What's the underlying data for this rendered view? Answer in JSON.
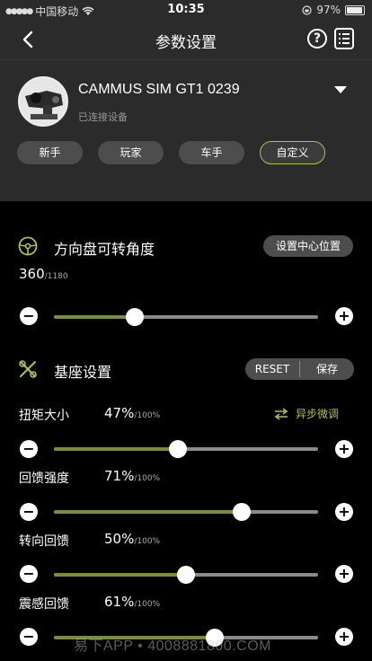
{
  "status_bar": {
    "carrier": "中国移动",
    "time": "10:35",
    "battery_text": "97%",
    "battery_level": 0.97
  },
  "header": {
    "title": "参数设置",
    "help_label": "?"
  },
  "device": {
    "name": "CAMMUS SIM GT1 0239",
    "status": "已连接设备",
    "modes": [
      {
        "label": "新手",
        "active": false
      },
      {
        "label": "玩家",
        "active": false
      },
      {
        "label": "车手",
        "active": false
      },
      {
        "label": "自定义",
        "active": true
      }
    ]
  },
  "steering": {
    "title": "方向盘可转角度",
    "center_button": "设置中心位置",
    "value": "360",
    "max": "/1180",
    "fraction": 0.305
  },
  "base": {
    "title": "基座设置",
    "reset_label": "RESET",
    "save_label": "保存",
    "async_label": "异步微调",
    "params": [
      {
        "label": "扭矩大小",
        "value": "47%",
        "max": "/100%",
        "fraction": 0.47
      },
      {
        "label": "回馈强度",
        "value": "71%",
        "max": "/100%",
        "fraction": 0.71
      },
      {
        "label": "转向回馈",
        "value": "50%",
        "max": "/100%",
        "fraction": 0.5
      },
      {
        "label": "震感回馈",
        "value": "61%",
        "max": "/100%",
        "fraction": 0.61
      }
    ]
  },
  "controls": {
    "minus": "−",
    "plus": "+"
  },
  "watermark": "易下APP • 4008881800.COM",
  "colors": {
    "accent": "#a7c54a",
    "fill": "#7a8f35",
    "panel": "#2b2b2b",
    "background": "#000000"
  },
  "icons": [
    "wifi-icon",
    "back-icon",
    "help-icon",
    "list-icon",
    "steering-wheel-icon",
    "tools-icon",
    "swap-arrows-icon"
  ]
}
